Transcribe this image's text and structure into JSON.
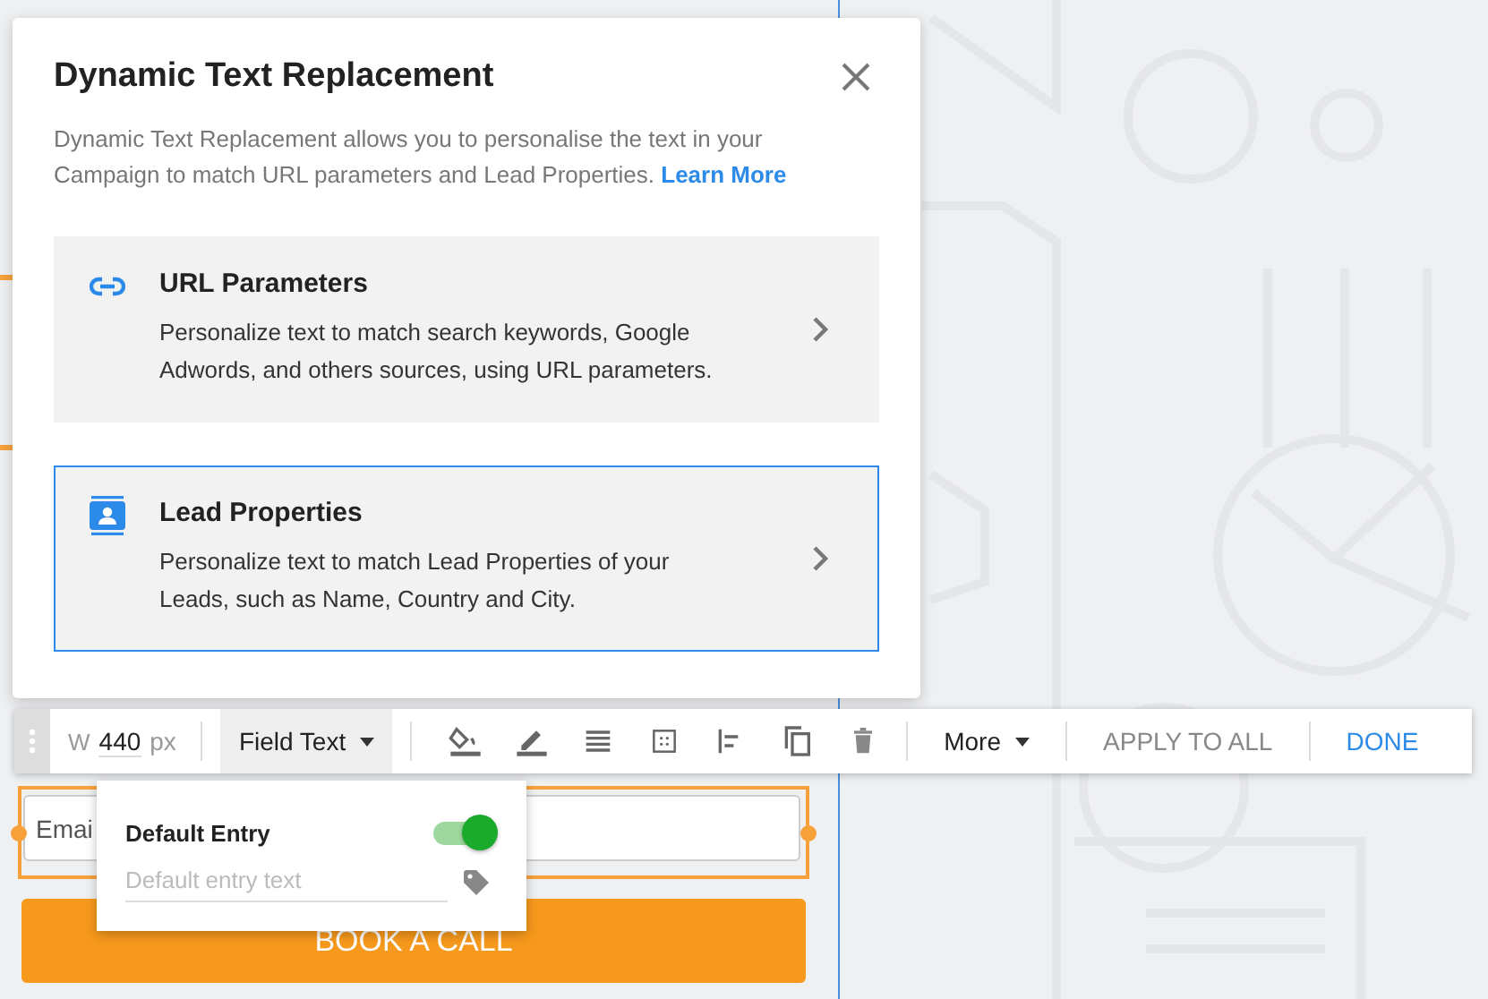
{
  "dialog": {
    "title": "Dynamic Text Replacement",
    "description": "Dynamic Text Replacement allows you to personalise the text in your Campaign to match URL parameters and Lead Properties.",
    "link": "Learn More",
    "options": [
      {
        "kind": "link",
        "title": "URL Parameters",
        "description": "Personalize text to match search keywords, Google Adwords, and others sources, using URL parameters.",
        "selected": false
      },
      {
        "kind": "contact",
        "title": "Lead Properties",
        "description": "Personalize text to match Lead Properties of your Leads, such as Name, Country and City.",
        "selected": true
      }
    ]
  },
  "toolbar": {
    "width_label": "W",
    "width_value": "440",
    "unit": "px",
    "field_menu": "Field Text",
    "tools": [
      {
        "kind": "fill"
      },
      {
        "kind": "pen"
      },
      {
        "kind": "lines"
      },
      {
        "kind": "padding"
      },
      {
        "kind": "align"
      },
      {
        "kind": "copy"
      },
      {
        "kind": "delete"
      }
    ],
    "more": "More",
    "apply": "APPLY TO ALL",
    "done": "DONE"
  },
  "popover": {
    "label": "Default Entry",
    "on": true,
    "placeholder": "Default entry text"
  },
  "form": {
    "email_placeholder": "Emai",
    "button": "BOOK A CALL"
  }
}
